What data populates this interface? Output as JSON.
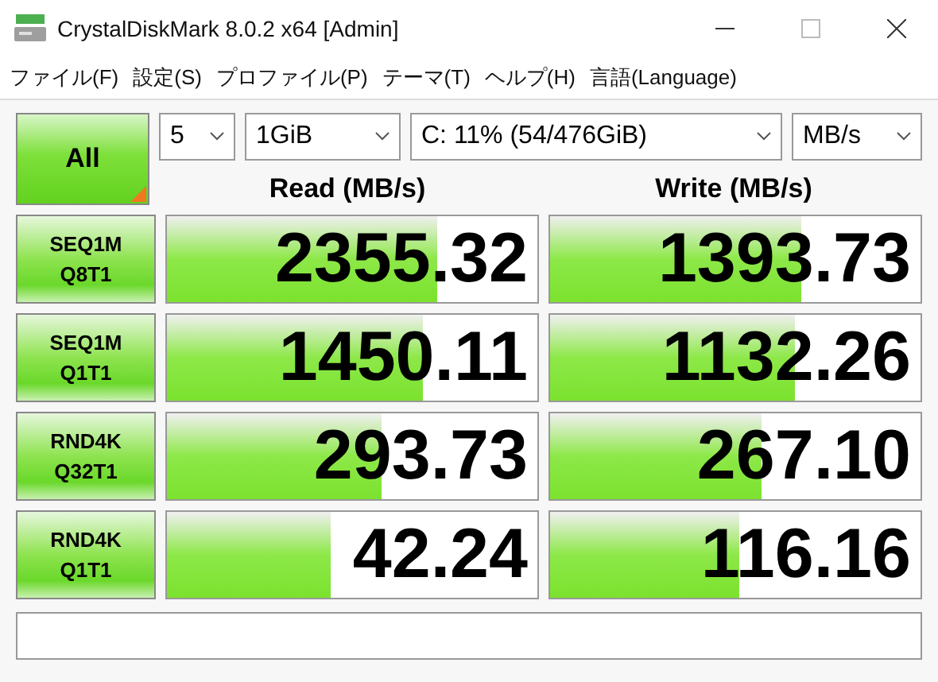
{
  "window": {
    "title": "CrystalDiskMark 8.0.2 x64 [Admin]"
  },
  "menu": [
    "ファイル(F)",
    "設定(S)",
    "プロファイル(P)",
    "テーマ(T)",
    "ヘルプ(H)",
    "言語(Language)"
  ],
  "all_button": "All",
  "selectors": [
    {
      "value": "5"
    },
    {
      "value": "1GiB"
    },
    {
      "value": "C: 11% (54/476GiB)"
    },
    {
      "value": "MB/s"
    }
  ],
  "headers": [
    "Read (MB/s)",
    "Write (MB/s)"
  ],
  "rows": [
    {
      "label_1": "SEQ1M",
      "label_2": "Q8T1",
      "read": {
        "value": "2355.32",
        "level": 0.73
      },
      "write": {
        "value": "1393.73",
        "level": 0.68
      }
    },
    {
      "label_1": "SEQ1M",
      "label_2": "Q1T1",
      "read": {
        "value": "1450.11",
        "level": 0.69
      },
      "write": {
        "value": "1132.26",
        "level": 0.66
      }
    },
    {
      "label_1": "RND4K",
      "label_2": "Q32T1",
      "read": {
        "value": "293.73",
        "level": 0.58
      },
      "write": {
        "value": "267.10",
        "level": 0.57
      }
    },
    {
      "label_1": "RND4K",
      "label_2": "Q1T1",
      "read": {
        "value": "42.24",
        "level": 0.44
      },
      "write": {
        "value": "116.16",
        "level": 0.51
      }
    }
  ]
}
